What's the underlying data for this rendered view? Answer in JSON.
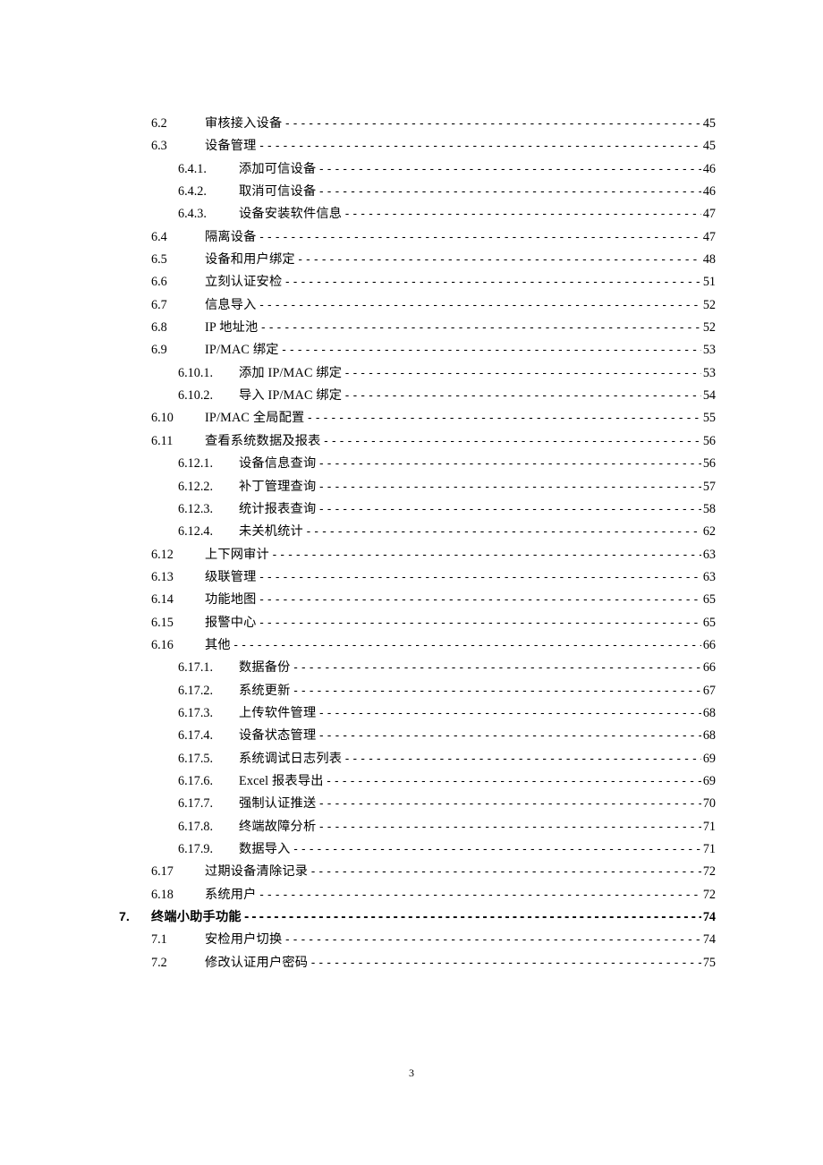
{
  "page_number": "3",
  "toc": [
    {
      "level": 2,
      "num": "6.2",
      "title": "审核接入设备",
      "page": "45"
    },
    {
      "level": 2,
      "num": "6.3",
      "title": "设备管理",
      "page": "45"
    },
    {
      "level": 3,
      "num": "6.4.1.",
      "title": "添加可信设备",
      "page": "46"
    },
    {
      "level": 3,
      "num": "6.4.2.",
      "title": "取消可信设备",
      "page": "46"
    },
    {
      "level": 3,
      "num": "6.4.3.",
      "title": "设备安装软件信息",
      "page": "47"
    },
    {
      "level": 2,
      "num": "6.4",
      "title": "隔离设备",
      "page": "47"
    },
    {
      "level": 2,
      "num": "6.5",
      "title": "设备和用户绑定",
      "page": "48"
    },
    {
      "level": 2,
      "num": "6.6",
      "title": "立刻认证安检",
      "page": "51"
    },
    {
      "level": 2,
      "num": "6.7",
      "title": "信息导入",
      "page": "52"
    },
    {
      "level": 2,
      "num": "6.8",
      "title": "IP 地址池",
      "page": "52"
    },
    {
      "level": 2,
      "num": "6.9",
      "title": "IP/MAC 绑定",
      "page": "53"
    },
    {
      "level": 3,
      "num": "6.10.1.",
      "title": "添加 IP/MAC 绑定",
      "page": "53"
    },
    {
      "level": 3,
      "num": "6.10.2.",
      "title": "导入 IP/MAC 绑定",
      "page": "54"
    },
    {
      "level": 2,
      "num": "6.10",
      "title": "IP/MAC 全局配置",
      "page": "55"
    },
    {
      "level": 2,
      "num": "6.11",
      "title": "查看系统数据及报表",
      "page": "56"
    },
    {
      "level": 3,
      "num": "6.12.1.",
      "title": "设备信息查询",
      "page": "56"
    },
    {
      "level": 3,
      "num": "6.12.2.",
      "title": "补丁管理查询",
      "page": "57"
    },
    {
      "level": 3,
      "num": "6.12.3.",
      "title": "统计报表查询",
      "page": "58"
    },
    {
      "level": 3,
      "num": "6.12.4.",
      "title": "未关机统计",
      "page": "62"
    },
    {
      "level": 2,
      "num": "6.12",
      "title": "上下网审计",
      "page": "63"
    },
    {
      "level": 2,
      "num": "6.13",
      "title": "级联管理",
      "page": "63"
    },
    {
      "level": 2,
      "num": "6.14",
      "title": "功能地图",
      "page": "65"
    },
    {
      "level": 2,
      "num": "6.15",
      "title": "报警中心",
      "page": "65"
    },
    {
      "level": 2,
      "num": "6.16",
      "title": "其他",
      "page": "66"
    },
    {
      "level": 3,
      "num": "6.17.1.",
      "title": "数据备份",
      "page": "66"
    },
    {
      "level": 3,
      "num": "6.17.2.",
      "title": "系统更新",
      "page": "67"
    },
    {
      "level": 3,
      "num": "6.17.3.",
      "title": "上传软件管理",
      "page": "68"
    },
    {
      "level": 3,
      "num": "6.17.4.",
      "title": "设备状态管理",
      "page": "68"
    },
    {
      "level": 3,
      "num": "6.17.5.",
      "title": "系统调试日志列表",
      "page": "69"
    },
    {
      "level": 3,
      "num": "6.17.6.",
      "title": "Excel 报表导出",
      "page": "69"
    },
    {
      "level": 3,
      "num": "6.17.7.",
      "title": "强制认证推送",
      "page": "70"
    },
    {
      "level": 3,
      "num": "6.17.8.",
      "title": "终端故障分析",
      "page": "71"
    },
    {
      "level": 3,
      "num": "6.17.9.",
      "title": "数据导入",
      "page": "71"
    },
    {
      "level": 2,
      "num": "6.17",
      "title": "过期设备清除记录",
      "page": "72"
    },
    {
      "level": 2,
      "num": "6.18",
      "title": "系统用户",
      "page": "72"
    },
    {
      "level": 1,
      "num": "7.",
      "title": "终端小助手功能",
      "page": "74"
    },
    {
      "level": 2,
      "num": "7.1",
      "title": "安检用户切换",
      "page": "74"
    },
    {
      "level": 2,
      "num": "7.2",
      "title": "修改认证用户密码",
      "page": "75"
    }
  ]
}
